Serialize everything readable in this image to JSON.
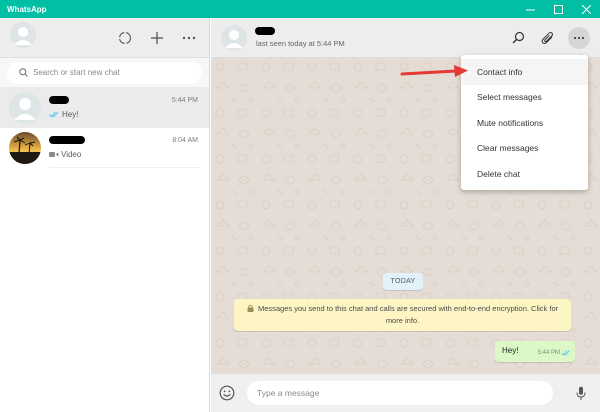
{
  "window": {
    "title": "WhatsApp",
    "titlebar_color": "#00bfa5",
    "controls": [
      "minimize-icon",
      "maximize-icon",
      "close-icon"
    ]
  },
  "sidebar": {
    "header_icons": [
      "status-icon",
      "new-chat-icon",
      "menu-icon"
    ],
    "search": {
      "placeholder": "Search or start new chat",
      "value": ""
    },
    "chats": [
      {
        "time": "5:44 PM",
        "preview": "Hey!",
        "preview_icon": "double-check-icon",
        "active": true
      },
      {
        "time": "8:04 AM",
        "preview": "Video",
        "preview_icon": "video-icon",
        "active": false
      }
    ]
  },
  "conversation": {
    "last_seen": "last seen today at 5:44 PM",
    "header_icons": [
      "search-icon",
      "attach-icon",
      "menu-icon"
    ],
    "day_label": "TODAY",
    "encryption_notice": "Messages you send to this chat and calls are secured with end-to-end encryption. Click for more info.",
    "messages": [
      {
        "text": "Hey!",
        "time": "5:44 PM",
        "status": "read"
      }
    ],
    "compose": {
      "placeholder": "Type a message",
      "value": ""
    }
  },
  "context_menu": {
    "items": [
      "Contact info",
      "Select messages",
      "Mute notifications",
      "Clear messages",
      "Delete chat"
    ]
  },
  "colors": {
    "accent": "#00bfa5",
    "chat_background": "#e5ddd5",
    "outgoing_bubble": "#dcf8c6",
    "notice_bubble": "#fdf5c4",
    "date_bubble": "#e1f2fb",
    "annotation_arrow": "#e53935",
    "read_ticks": "#4fc3f7"
  }
}
